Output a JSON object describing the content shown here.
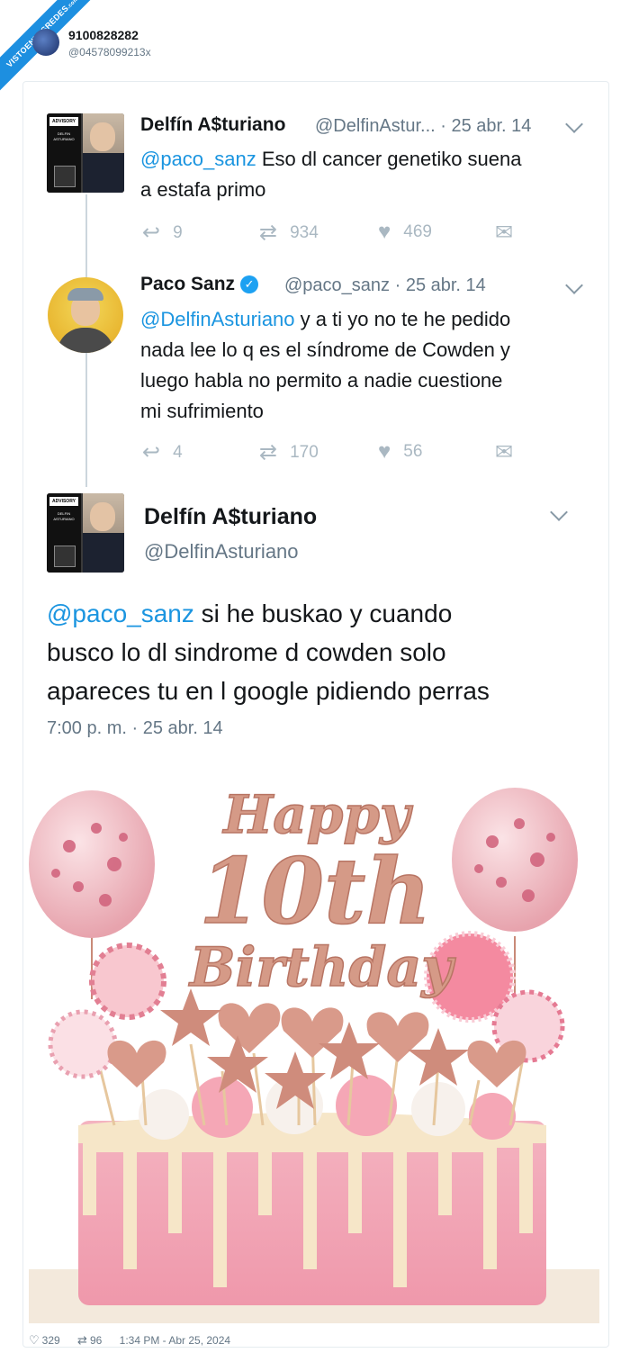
{
  "watermark": {
    "brand": "VISTOENLASREDES",
    "suffix": ".com"
  },
  "header": {
    "name": "9100828282",
    "handle": "@04578099213x"
  },
  "thread": [
    {
      "name": "Delfín A$turiano",
      "meta": "@DelfinAstur... · 25 abr. 14",
      "mention": "@paco_sanz",
      "line1": " Eso dl cancer genetiko suena",
      "line2": "a estafa primo",
      "replies": "9",
      "retweets": "934",
      "likes": "469"
    },
    {
      "name": "Paco Sanz",
      "meta": "@paco_sanz · 25 abr. 14",
      "mention": "@DelfinAsturiano",
      "line1": " y a ti yo no te he pedido",
      "line2": "nada lee lo q es el síndrome de Cowden y",
      "line3": "luego habla no permito a nadie cuestione",
      "line4": "mi sufrimiento",
      "replies": "4",
      "retweets": "170",
      "likes": "56"
    }
  ],
  "main_tweet": {
    "name": "Delfín A$turiano",
    "handle": "@DelfinAsturiano",
    "mention": "@paco_sanz",
    "line1": " si he buskao y cuando",
    "line2": "busco lo dl sindrome d cowden solo",
    "line3": "apareces tu en l google pidiendo perras",
    "timestamp": "7:00 p. m. · 25 abr. 14"
  },
  "attached_image": {
    "topper_line1": "Happy",
    "topper_line2": "10th",
    "topper_line3": "Birthday",
    "colors": {
      "rose_gold": "#c98a78",
      "cake_pink": "#f2a9b8",
      "drip": "#f6e6c8"
    }
  },
  "footer": {
    "likes": "329",
    "retweets": "96",
    "timestamp": "1:34 PM - Abr 25, 2024"
  },
  "icons": [
    "reply-icon",
    "retweet-icon",
    "heart-icon",
    "dm-icon",
    "verified-icon",
    "chevron-down-icon"
  ]
}
